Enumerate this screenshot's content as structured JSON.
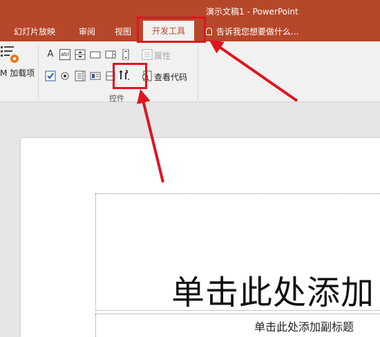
{
  "window": {
    "title": "演示文稿1 - PowerPoint"
  },
  "tabs": [
    {
      "label": "幻灯片放映"
    },
    {
      "label": "审阅"
    },
    {
      "label": "视图"
    }
  ],
  "active_tab": {
    "label": "开发工具"
  },
  "tell_me": {
    "text": "告诉我您想要做什么..."
  },
  "ribbon": {
    "addins": {
      "label": "加载项",
      "prefix": "M"
    },
    "controls_group": {
      "label": "控件",
      "properties_label": "属性",
      "view_code_label": "查看代码",
      "label_control": "A",
      "textbox_control": "abl"
    }
  },
  "slide": {
    "title_placeholder": "单击此处添加",
    "subtitle_placeholder": "单击此处添加副标题"
  },
  "colors": {
    "brand": "#b7472a",
    "highlight": "#e0141e"
  }
}
